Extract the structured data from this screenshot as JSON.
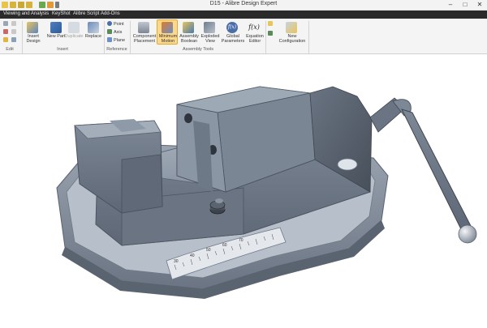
{
  "window": {
    "title": "D15 - Alibre Design Expert"
  },
  "menubar": {
    "items": [
      "Viewing and Analysis",
      "KeyShot",
      "Alibre Script",
      "Add-Ons"
    ]
  },
  "ribbon": {
    "buttons": {
      "insert_design": "Insert Design",
      "new_part": "New Part",
      "duplicate": "Duplicate",
      "replace": "Replace",
      "point": "Point",
      "axis": "Axis",
      "plane": "Plane",
      "component_placement": "Component Placement",
      "minimum_motion": "Minimum Motion",
      "assembly_boolean": "Assembly Boolean",
      "exploded_view": "Exploded View",
      "global_parameters": "Global Parameters",
      "equation_editor": "Equation Editor",
      "new_configuration": "New Configuration"
    },
    "groups": {
      "edit": "Edit",
      "insert": "Insert",
      "reference": "Reference",
      "assembly_tools": "Assembly Tools"
    },
    "icons": {
      "equation": "f(x)",
      "global": "f(x)"
    }
  },
  "viewport": {
    "model": "machine vise assembly",
    "dial_labels": [
      "30",
      "40",
      "50",
      "60",
      "70"
    ]
  },
  "colors": {
    "menubar_bg": "#2b2b2b",
    "ribbon_bg": "#f4f4f4",
    "active_button": "#fbd88a",
    "part_blue_gray": "#8b98a8"
  }
}
